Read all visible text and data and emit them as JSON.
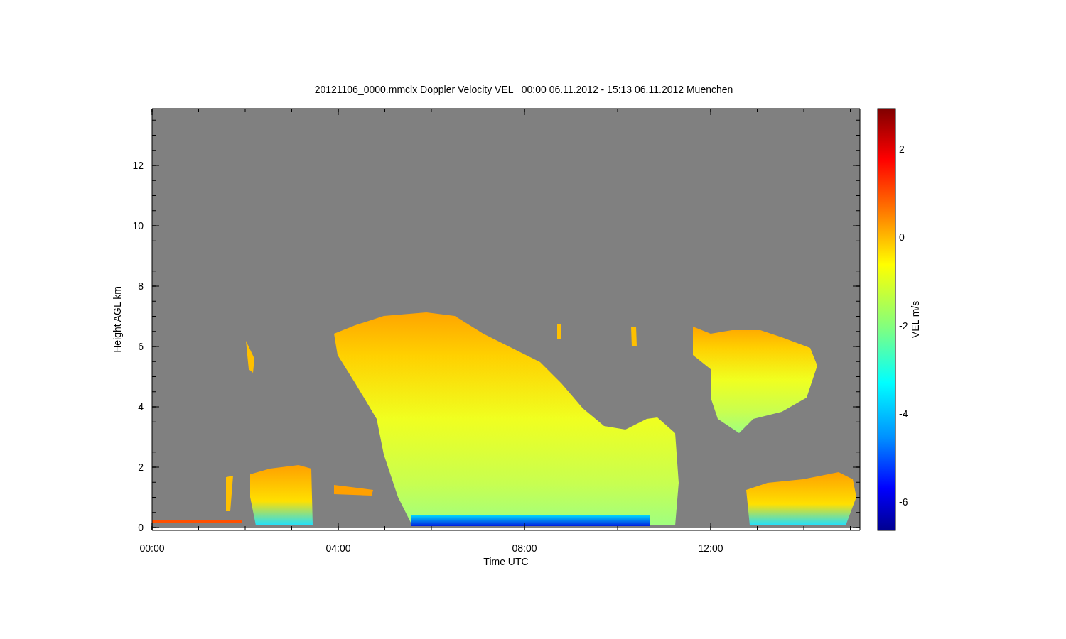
{
  "title": "20121106_0000.mmclx Doppler Velocity VEL   00:00 06.11.2012 - 15:13 06.11.2012 Muenchen",
  "x_axis": {
    "label": "Time UTC",
    "ticks": [
      "00:00",
      "04:00",
      "08:00",
      "12:00"
    ]
  },
  "y_axis": {
    "label": "Height AGL km",
    "ticks": [
      "12",
      "10",
      "8",
      "6",
      "4",
      "2",
      "0"
    ]
  },
  "colorbar": {
    "label": "VEL m/s",
    "ticks": [
      "2",
      "0",
      "-2",
      "-4",
      "-6"
    ]
  }
}
